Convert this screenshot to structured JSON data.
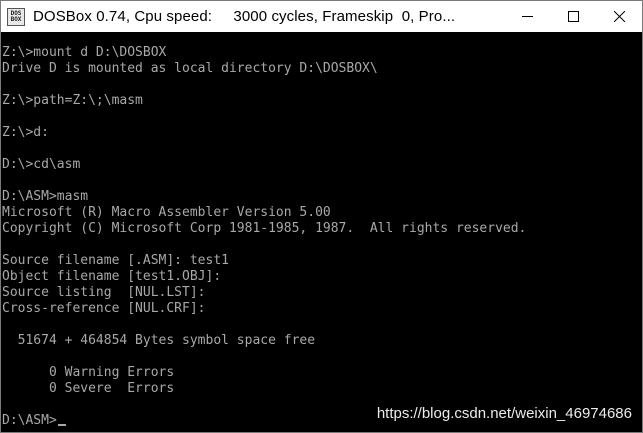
{
  "window": {
    "title": "DOSBox 0.74, Cpu speed:     3000 cycles, Frameskip  0, Pro...",
    "icon_lines": [
      "DOS",
      "BOX"
    ],
    "controls": [
      "minimize-icon",
      "maximize-icon",
      "close-icon"
    ]
  },
  "console": {
    "lines": [
      "Z:\\>mount d D:\\DOSBOX",
      "Drive D is mounted as local directory D:\\DOSBOX\\",
      "",
      "Z:\\>path=Z:\\;\\masm",
      "",
      "Z:\\>d:",
      "",
      "D:\\>cd\\asm",
      "",
      "D:\\ASM>masm",
      "Microsoft (R) Macro Assembler Version 5.00",
      "Copyright (C) Microsoft Corp 1981-1985, 1987.  All rights reserved.",
      "",
      "Source filename [.ASM]: test1",
      "Object filename [test1.OBJ]:",
      "Source listing  [NUL.LST]:",
      "Cross-reference [NUL.CRF]:",
      "",
      "  51674 + 464854 Bytes symbol space free",
      "",
      "      0 Warning Errors",
      "      0 Severe  Errors",
      "",
      "D:\\ASM>"
    ]
  },
  "watermark": "https://blog.csdn.net/weixin_46974686",
  "colors": {
    "console_bg": "#000000",
    "console_fg": "#a8a8a8",
    "titlebar_bg": "#ffffff"
  }
}
